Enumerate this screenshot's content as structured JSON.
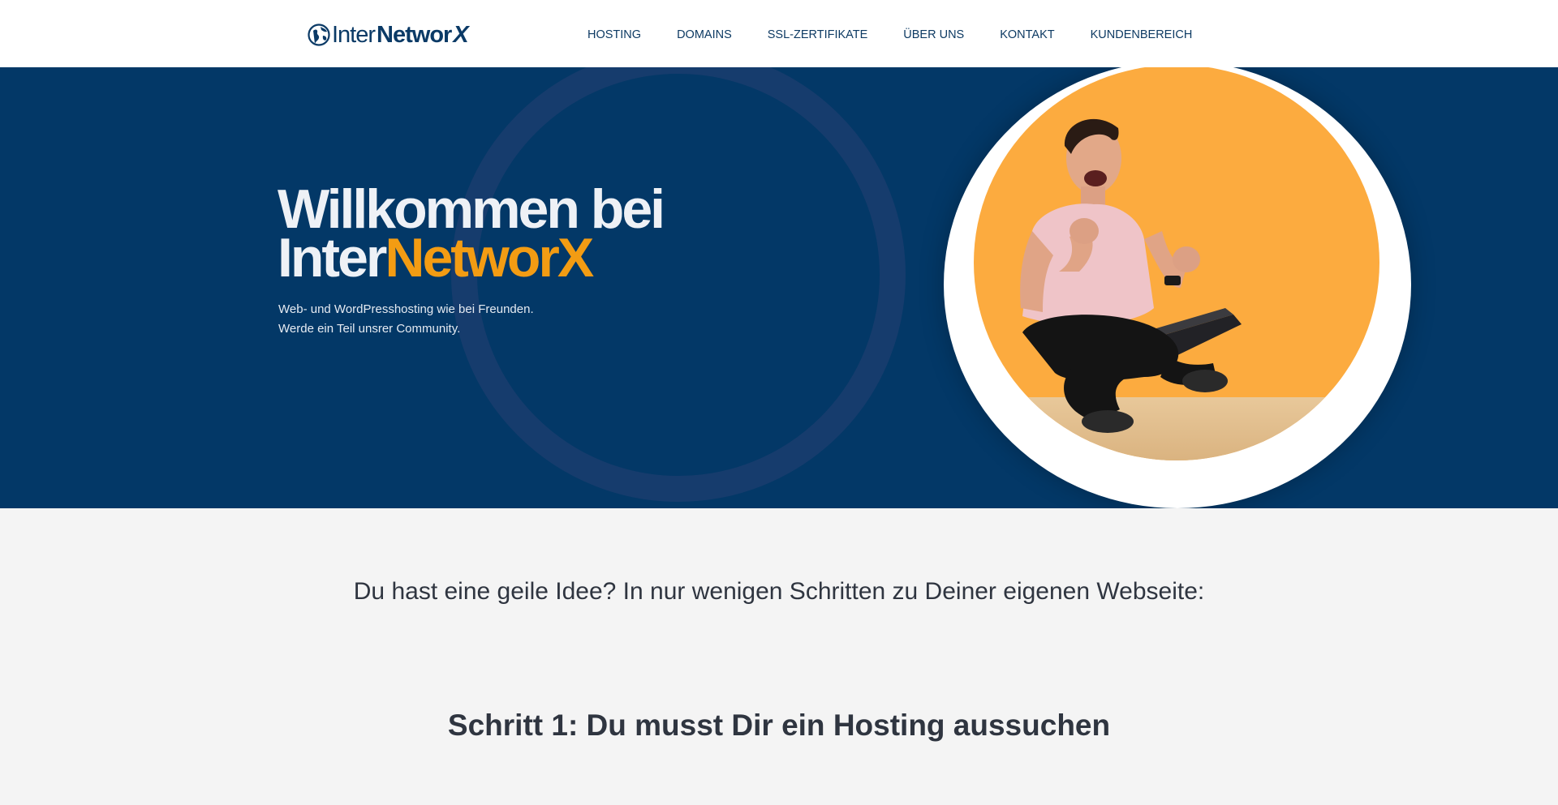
{
  "header": {
    "logo": {
      "part1": "Inter",
      "part2": "Networ",
      "part3": "X"
    },
    "nav": [
      {
        "label": "HOSTING"
      },
      {
        "label": "DOMAINS"
      },
      {
        "label": "SSL-ZERTIFIKATE"
      },
      {
        "label": "ÜBER UNS"
      },
      {
        "label": "KONTAKT"
      },
      {
        "label": "KUNDENBEREICH"
      }
    ]
  },
  "hero": {
    "title_line1": "Willkommen bei",
    "title_line2_a": "Inter",
    "title_line2_b": "NetworX",
    "sub_line1": "Web- und WordPresshosting wie bei Freunden.",
    "sub_line2": "Werde ein Teil unsrer Community."
  },
  "content": {
    "intro": "Du hast eine geile Idee? In nur wenigen Schritten zu Deiner eigenen Webseite:",
    "step1": "Schritt 1: Du musst Dir ein Hosting aussuchen"
  },
  "colors": {
    "brand_blue": "#033867",
    "accent_orange": "#f39c13",
    "photo_background": "#fcab3f"
  }
}
